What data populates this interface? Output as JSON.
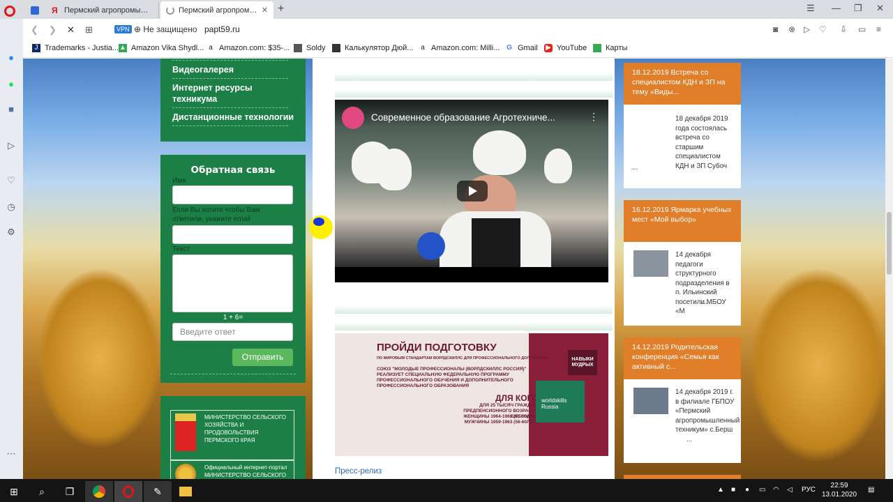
{
  "browser": {
    "tabs": [
      {
        "label": ""
      },
      {
        "label": "Пермский агропромыш..."
      },
      {
        "label": "Пермский агропромыш..."
      }
    ],
    "security": "Не защищено",
    "vpn_badge": "VPN",
    "url": "papt59.ru",
    "bookmarks": [
      {
        "label": "Trademarks - Justia..."
      },
      {
        "label": "Amazon Vika Shydl..."
      },
      {
        "label": "Amazon.com: $35-..."
      },
      {
        "label": "Soldy"
      },
      {
        "label": "Калькулятор Дюй..."
      },
      {
        "label": "Amazon.com: Milli..."
      },
      {
        "label": "Gmail"
      },
      {
        "label": "YouTube"
      },
      {
        "label": "Карты"
      }
    ]
  },
  "left_menu": {
    "items": [
      {
        "label": "Видеогалерея"
      },
      {
        "label": "Интернет ресурсы техникума"
      },
      {
        "label": "Дистанционные технологии"
      }
    ]
  },
  "feedback": {
    "title": "Обратная связь",
    "name_label": "Имя",
    "email_label": "Если Вы хотите чтобы Вам ответили, укажите email",
    "text_label": "Текст",
    "captcha": "1 + 6=",
    "answer_placeholder": "Введите ответ",
    "submit_label": "Отправить"
  },
  "links": [
    {
      "text": "МИНИСТЕРСТВО СЕЛЬСКОГО ХОЗЯЙСТВА И ПРОДОВОЛЬСТВИЯ ПЕРМСКОГО КРАЯ"
    },
    {
      "text": "Официальный интернет-портал МИНИСТЕРСТВО СЕЛЬСКОГО ХОЗЯЙСТВА РОССИЙСКОЙ"
    }
  ],
  "video": {
    "title": "Современное образование Агротехниче..."
  },
  "banner": {
    "heading": "ПРОЙДИ ПОДГОТОВКУ",
    "subheading": "ПО МИРОВЫМ СТАНДАРТАМ ВОРЛДСКИЛЛС ДЛЯ ПРОФЕССИОНАЛЬНОГО ДОЛГОЛЕТИЯ",
    "body": "СОЮЗ \"МОЛОДЫЕ ПРОФЕССИОНАЛЫ (ВОРЛДСКИЛЛС РОССИЯ)\" РЕАЛИЗУЕТ СПЕЦИАЛЬНУЮ ФЕДЕРАЛЬНУЮ ПРОГРАММУ ПРОФЕССИОНАЛЬНОГО ОБУЧЕНИЯ И ДОПОЛНИТЕЛЬНОГО ПРОФЕССИОНАЛЬНОГО ОБРАЗОВАНИЯ",
    "who": "ДЛЯ КОГО?",
    "who_1": "ДЛЯ 25 ТЫСЯЧ ГРАЖДАН",
    "who_2": "ПРЕДПЕНСИОННОГО ВОЗРАСТА ЕЖЕГОДНО",
    "who_3": "ЖЕНЩИНЫ 1964-1968 (51-55ЛЕТ)",
    "who_4": "МУЖЧИНЫ 1959-1963 (56-60ЛЕТ)",
    "badge": "НАВЫКИ МУДРЫХ",
    "brand": "worldskills Russia"
  },
  "press_link": "Пресс-релиз",
  "news": [
    {
      "title": "18.12.2019 Встреча со специалистом КДН и ЗП на тему «Виды...",
      "text": "18 декабря 2019 года состоялась встреча со старшим специалистом КДН и ЗП Субоч",
      "more": "..."
    },
    {
      "title": "16.12.2019 Ярмарка учебных мест «Мой выбор»",
      "text": "14 декабря педагоги структурного подразделения в п. Ильинский посетили МБОУ «М",
      "more": "..."
    },
    {
      "title": "14.12.2019 Родительская конференция «Семья как активный с...",
      "text": "14 декабря 2019 г. в филиале ГБПОУ «Пермский агропромышленный техникум» с.Берш",
      "more": "..."
    }
  ],
  "taskbar": {
    "lang": "РУС",
    "time": "22:59",
    "date": "13.01.2020"
  }
}
